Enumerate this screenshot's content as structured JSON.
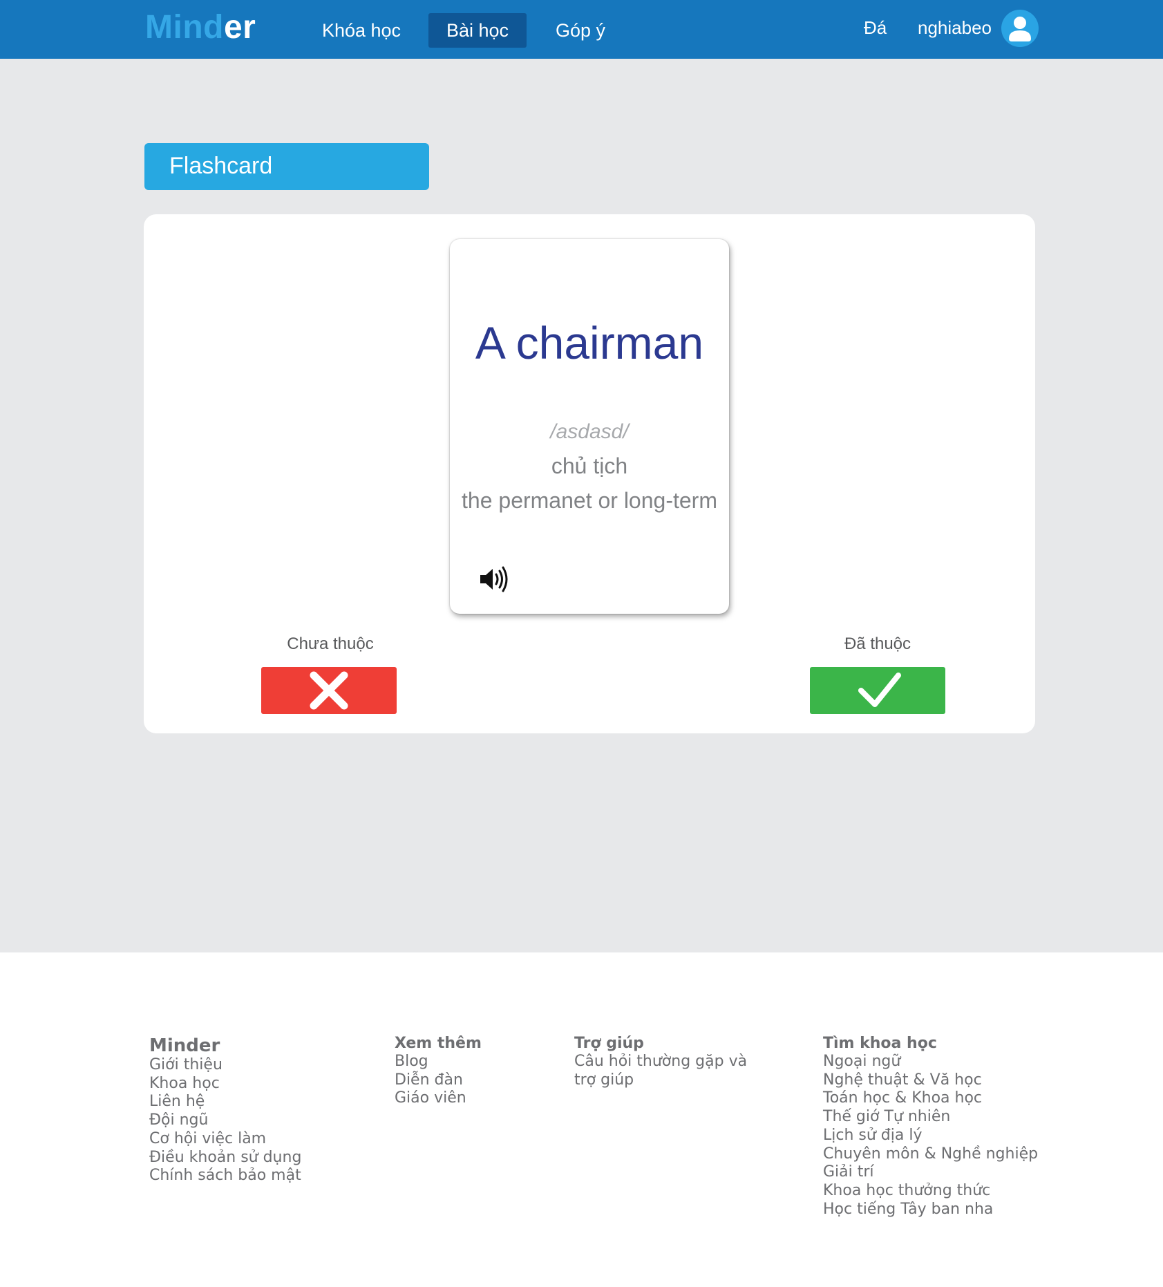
{
  "header": {
    "logo": {
      "part1": "Mind",
      "part2": "er"
    },
    "nav": [
      {
        "label": "Khóa học"
      },
      {
        "label": "Bài học",
        "active": true
      },
      {
        "label": "Góp ý"
      }
    ],
    "stone_label": "Đá",
    "username": "nghiabeo",
    "colors": {
      "bar": "#1677bd",
      "active": "#0f5796",
      "logo_accent": "#35a7e6"
    }
  },
  "main": {
    "section_title": "Flashcard",
    "card": {
      "word": "A chairman",
      "phonetic": "/asdasd/",
      "meaning": "chủ tịch",
      "definition": "the permanet or long-term",
      "audio_icon": "speaker-icon"
    },
    "actions": {
      "unknown_label": "Chưa thuộc",
      "known_label": "Đã thuộc",
      "unknown_icon": "close-x-icon",
      "known_icon": "checkmark-icon",
      "colors": {
        "unknown": "#ef3e36",
        "known": "#3bb549"
      }
    }
  },
  "footer": {
    "columns": [
      {
        "heading": "Minder",
        "links": [
          "Giới thiệu",
          "Khoa học",
          "Liên hệ",
          "Đội ngũ",
          "Cơ hội việc làm",
          "Điều khoản sử dụng",
          "Chính sách bảo mật"
        ]
      },
      {
        "heading": "Xem thêm",
        "links": [
          "Blog",
          "Diễn đàn",
          "Giáo viên"
        ]
      },
      {
        "heading": "Trợ giúp",
        "links": [
          "Câu hỏi thường gặp và",
          "trợ giúp"
        ]
      },
      {
        "heading": "Tìm khoa học",
        "links": [
          "Ngoại ngữ",
          "Nghệ thuật & Vă học",
          "Toán học & Khoa học",
          "Thế giớ Tự nhiên",
          "Lịch sử địa lý",
          "Chuyên môn & Nghề nghiệp",
          "Giải trí",
          "Khoa học thưởng thức",
          "Học tiếng Tây ban nha"
        ]
      }
    ]
  }
}
